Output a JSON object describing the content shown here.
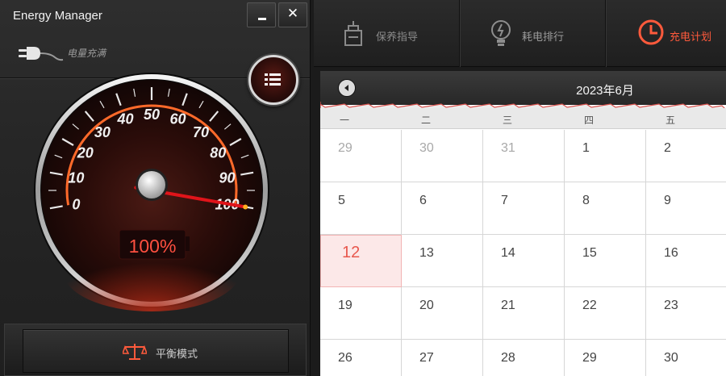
{
  "app": {
    "title": "Energy Manager",
    "minimize_glyph": "–",
    "close_glyph": "✕"
  },
  "power": {
    "status": "电量充满",
    "plug_icon": "power-plug-icon"
  },
  "gauge": {
    "percent_label": "100%",
    "level_percent": 100,
    "ticks": [
      "0",
      "10",
      "20",
      "30",
      "40",
      "50",
      "60",
      "70",
      "80",
      "90",
      "100"
    ]
  },
  "mode": {
    "label": "平衡模式",
    "icon": "balance-scale-icon"
  },
  "tabs": [
    {
      "label": "保养指导",
      "icon": "maintenance-icon",
      "active": false
    },
    {
      "label": "耗电排行",
      "icon": "lightbulb-icon",
      "active": false
    },
    {
      "label": "充电计划",
      "icon": "clock-icon",
      "active": true
    }
  ],
  "calendar": {
    "month_title": "2023年6月",
    "weekdays": [
      "一",
      "二",
      "三",
      "四",
      "五"
    ],
    "weeks": [
      [
        "29",
        "30",
        "31",
        "1",
        "2"
      ],
      [
        "5",
        "6",
        "7",
        "8",
        "9"
      ],
      [
        "12",
        "13",
        "14",
        "15",
        "16"
      ],
      [
        "19",
        "20",
        "21",
        "22",
        "23"
      ],
      [
        "26",
        "27",
        "28",
        "29",
        "30"
      ]
    ],
    "today": "12"
  },
  "colors": {
    "accent": "#ff5a3c",
    "today_text": "#e8574d",
    "today_bg": "#fce8e8"
  }
}
